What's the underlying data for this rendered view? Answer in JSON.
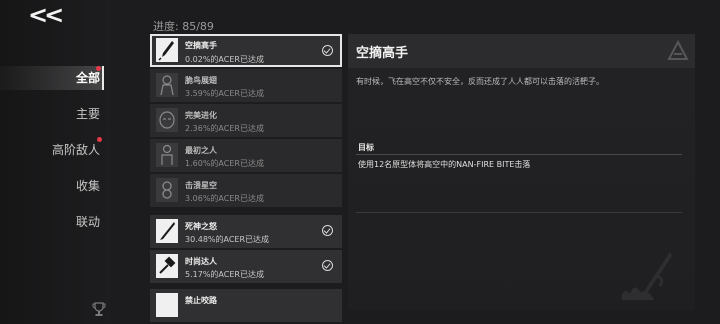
{
  "nav": {
    "back_label": "<<",
    "items": [
      {
        "label": "全部",
        "active": true,
        "badge": true
      },
      {
        "label": "主要",
        "active": false,
        "badge": false
      },
      {
        "label": "高阶敌人",
        "active": false,
        "badge": true
      },
      {
        "label": "收集",
        "active": false,
        "badge": false
      },
      {
        "label": "联动",
        "active": false,
        "badge": false
      }
    ]
  },
  "progress": {
    "label": "进度: 85/89"
  },
  "achievements": [
    {
      "title": "空摘高手",
      "percent": "0.02%的ACER已达成",
      "completed": true,
      "selected": true,
      "icon": "pen-icon"
    },
    {
      "title": "脆鸟展翅",
      "percent": "3.59%的ACER已达成",
      "completed": false,
      "selected": false,
      "icon": "figure-icon"
    },
    {
      "title": "完美进化",
      "percent": "2.36%的ACER已达成",
      "completed": false,
      "selected": false,
      "icon": "mask-icon"
    },
    {
      "title": "最初之人",
      "percent": "1.60%的ACER已达成",
      "completed": false,
      "selected": false,
      "icon": "figure-icon"
    },
    {
      "title": "击溃星空",
      "percent": "3.06%的ACER已达成",
      "completed": false,
      "selected": false,
      "icon": "chain-icon"
    },
    {
      "title": "死神之怒",
      "percent": "30.48%的ACER已达成",
      "completed": true,
      "selected": false,
      "icon": "blade-icon"
    },
    {
      "title": "时尚达人",
      "percent": "5.17%的ACER已达成",
      "completed": true,
      "selected": false,
      "icon": "hammer-icon"
    },
    {
      "title": "禁止咬路",
      "percent": "",
      "completed": false,
      "selected": false,
      "icon": "blank-icon"
    }
  ],
  "detail": {
    "title": "空摘高手",
    "description": "有时候，飞在高空不仅不安全，反而还成了人人都可以击落的活靶子。",
    "goal_label": "目标",
    "goal_text": "使用12名原型体将高空中的NAN-FIRE BITE击落"
  },
  "colors": {
    "accent_red": "#e8384a",
    "selected_border": "#e6e6e6"
  }
}
